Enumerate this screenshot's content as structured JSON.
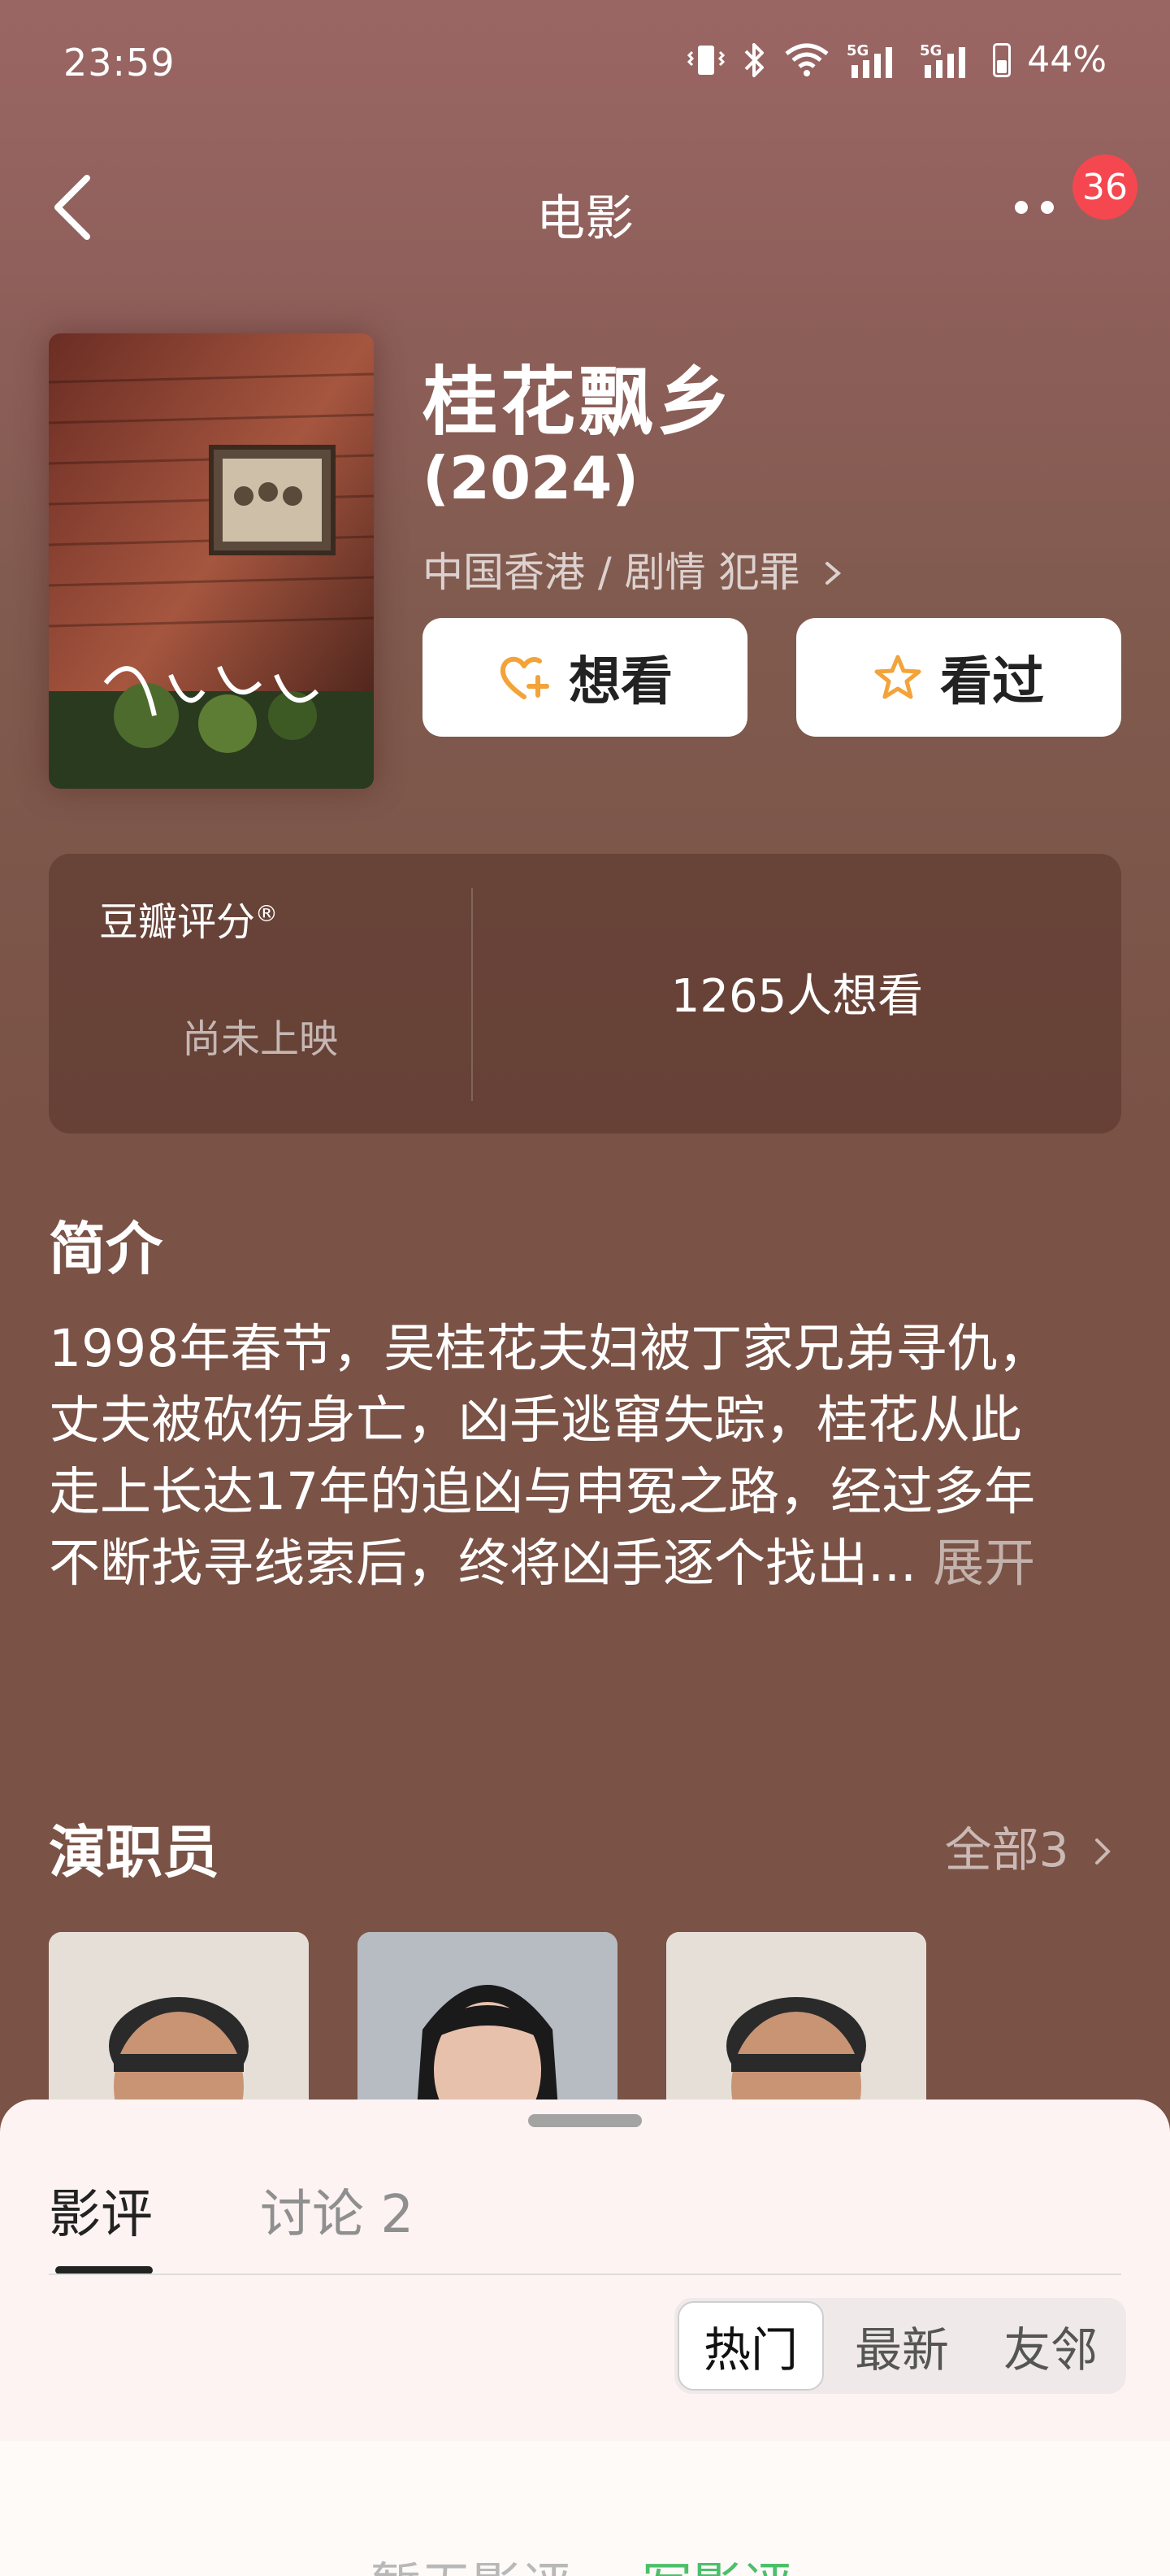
{
  "status_bar": {
    "time": "23:59",
    "network_1": "5G",
    "network_2": "5G",
    "battery": "44%"
  },
  "nav": {
    "title": "电影",
    "badge_count": "36"
  },
  "movie": {
    "title": "桂花飘乡",
    "year": "(2024)",
    "meta": "中国香港 / 剧情 犯罪",
    "want_button": "想看",
    "seen_button": "看过"
  },
  "rating": {
    "label": "豆瓣评分",
    "label_mark": "®",
    "status": "尚未上映",
    "want_count": "1265人想看"
  },
  "synopsis": {
    "title": "简介",
    "lines": [
      "1998年春节，吴桂花夫妇被丁家兄弟寻仇，",
      "丈夫被砍伤身亡，凶手逃窜失踪，桂花从此",
      "走上长达17年的追凶与申冤之路，经过多年",
      "不断找寻线索后，终将凶手逐个找出..."
    ],
    "expand": "展开"
  },
  "cast": {
    "title": "演职员",
    "all_label": "全部3"
  },
  "sheet": {
    "tab_reviews": "影评",
    "tab_discussions": "讨论 2",
    "sort_hot": "热门",
    "sort_new": "最新",
    "sort_friends": "友邻"
  },
  "footer": {
    "no_reviews": "暂无影评",
    "write_review": "写影评"
  },
  "colors": {
    "badge": "#f5474f",
    "want_icon": "#f2a33a",
    "seen_icon": "#f2a33a",
    "write_link": "#4cbf6b"
  }
}
